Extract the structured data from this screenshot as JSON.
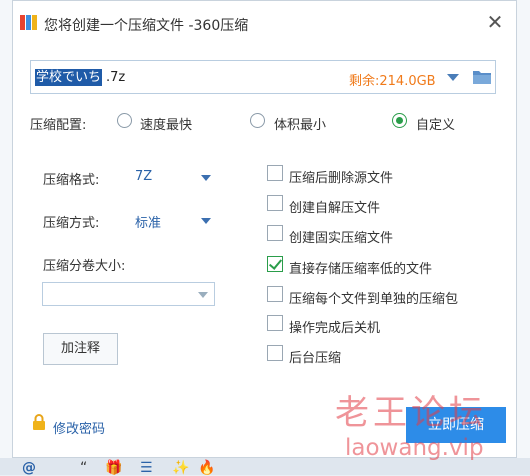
{
  "window": {
    "title": "您将创建一个压缩文件 -360压缩",
    "close": "✕"
  },
  "filename": {
    "selected": "学校でいち",
    "rest": ".7z",
    "free_space": "剩余:214.0GB"
  },
  "config": {
    "label": "压缩配置:",
    "options": [
      {
        "label": "速度最快",
        "selected": false
      },
      {
        "label": "体积最小",
        "selected": false
      },
      {
        "label": "自定义",
        "selected": true
      }
    ]
  },
  "format": {
    "label": "压缩格式:",
    "value": "7Z"
  },
  "method": {
    "label": "压缩方式:",
    "value": "标准"
  },
  "volume": {
    "label": "压缩分卷大小:",
    "value": ""
  },
  "comment_button": "加注释",
  "checkboxes": [
    {
      "label": "压缩后删除源文件",
      "checked": false
    },
    {
      "label": "创建自解压文件",
      "checked": false
    },
    {
      "label": "创建固实压缩文件",
      "checked": false
    },
    {
      "label": "直接存储压缩率低的文件",
      "checked": true
    },
    {
      "label": "压缩每个文件到单独的压缩包",
      "checked": false
    },
    {
      "label": "操作完成后关机",
      "checked": false
    },
    {
      "label": "后台压缩",
      "checked": false
    }
  ],
  "password_link": "修改密码",
  "compress_button": "立即压缩",
  "watermark": {
    "line1": "老王论坛",
    "line2": "laowang.vip"
  },
  "taskbar_icons": [
    "@",
    "“",
    "🎁",
    "☰",
    "✨",
    "🔥"
  ],
  "colors": {
    "accent": "#2d8ce8",
    "link": "#2a62a8",
    "free_space": "#f07a1a",
    "check": "#2a9d4a",
    "selection": "#1f5ba8"
  }
}
